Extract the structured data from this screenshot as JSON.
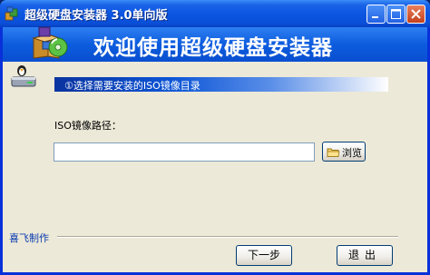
{
  "window": {
    "title": "超级硬盘安装器 3.0单向版",
    "icon": "app-boxes-icon",
    "controls": {
      "minimize": "minimize-icon",
      "maximize": "maximize-icon",
      "close": "close-icon"
    }
  },
  "banner": {
    "title": "欢迎使用超级硬盘安装器",
    "logo": "boxes-cd-icon"
  },
  "step": {
    "icon": "hard-drive-penguin-icon",
    "text": "①选择需要安装的ISO镜像目录"
  },
  "form": {
    "iso_label": "ISO镜像路径：",
    "iso_path_value": "",
    "browse_label": "浏览",
    "browse_icon": "folder-icon"
  },
  "footer": {
    "author": "喜飞制作",
    "next_label": "下一步",
    "exit_label": "退出"
  },
  "colors": {
    "titlebar": "#0a55e0",
    "banner": "#0c5cde",
    "client_bg": "#ece9d8",
    "author_text": "#0a3cb0"
  }
}
